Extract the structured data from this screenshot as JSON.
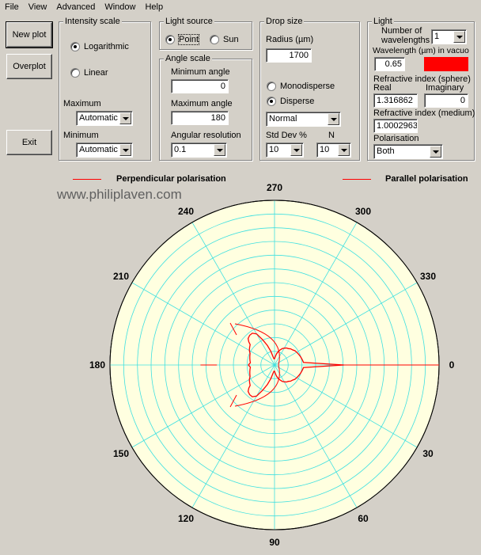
{
  "menu": [
    "File",
    "View",
    "Advanced",
    "Window",
    "Help"
  ],
  "buttons": {
    "new_plot": "New plot",
    "overplot": "Overplot",
    "exit": "Exit"
  },
  "intensity": {
    "title": "Intensity scale",
    "logarithmic": "Logarithmic",
    "linear": "Linear",
    "maximum_label": "Maximum",
    "maximum_value": "Automatic",
    "minimum_label": "Minimum",
    "minimum_value": "Automatic"
  },
  "light_source": {
    "title": "Light source",
    "point": "Point",
    "sun": "Sun"
  },
  "angle_scale": {
    "title": "Angle scale",
    "min_label": "Minimum angle",
    "min_value": "0",
    "max_label": "Maximum angle",
    "max_value": "180",
    "res_label": "Angular resolution",
    "res_value": "0.1"
  },
  "drop_size": {
    "title": "Drop size",
    "radius_label": "Radius (µm)",
    "radius_value": "1700",
    "monodisperse": "Monodisperse",
    "disperse": "Disperse",
    "distribution": "Normal",
    "stddev_label": "Std Dev %",
    "stddev_value": "10",
    "n_label": "N",
    "n_value": "10"
  },
  "light": {
    "title": "Light",
    "num_wavelengths_label_1": "Number of",
    "num_wavelengths_label_2": "wavelengths",
    "num_wavelengths_value": "1",
    "wavelength_label": "Wavelength (µm) in vacuo",
    "wavelength_value": "0.65",
    "wavelength_color": "#ff0000",
    "ri_sphere_label": "Refractive index (sphere)",
    "real_label": "Real",
    "imag_label": "Imaginary",
    "real_value": "1.316862",
    "imag_value": "0",
    "ri_medium_label": "Refractive index (medium)",
    "ri_medium_value": "1.0002963",
    "polarisation_label": "Polarisation",
    "polarisation_value": "Both"
  },
  "legend": {
    "perpendicular": "Perpendicular polarisation",
    "parallel": "Parallel polarisation"
  },
  "watermark": "www.philiplaven.com",
  "chart_data": {
    "type": "polar",
    "angle_labels": [
      "0",
      "30",
      "60",
      "90",
      "120",
      "150",
      "180",
      "210",
      "240",
      "270",
      "300",
      "330"
    ],
    "angles_deg": [
      0,
      30,
      60,
      90,
      120,
      150,
      180,
      210,
      240,
      270,
      300,
      330
    ],
    "rings": 12,
    "background": "#ffffe0",
    "grid_color": "#40e0e0",
    "series_color": "#ff0000",
    "series": [
      {
        "name": "Perpendicular polarisation"
      },
      {
        "name": "Parallel polarisation"
      }
    ],
    "radius_normalized": {
      "angles_deg": [
        0,
        5,
        10,
        15,
        20,
        25,
        30,
        35,
        40,
        45,
        50,
        55,
        60,
        65,
        70,
        75,
        80,
        85,
        90,
        95,
        100,
        105,
        110,
        115,
        120,
        125,
        130,
        135,
        138,
        140,
        145,
        150,
        155,
        160,
        165,
        170,
        175,
        180
      ],
      "values": [
        1.0,
        0.42,
        0.41,
        0.4,
        0.39,
        0.38,
        0.37,
        0.36,
        0.34,
        0.33,
        0.31,
        0.3,
        0.28,
        0.26,
        0.23,
        0.2,
        0.16,
        0.12,
        0.09,
        0.09,
        0.12,
        0.2,
        0.3,
        0.4,
        0.52,
        0.56,
        0.56,
        0.54,
        0.5,
        0.46,
        0.44,
        0.42,
        0.39,
        0.38,
        0.37,
        0.36,
        0.35,
        0.38
      ]
    }
  }
}
